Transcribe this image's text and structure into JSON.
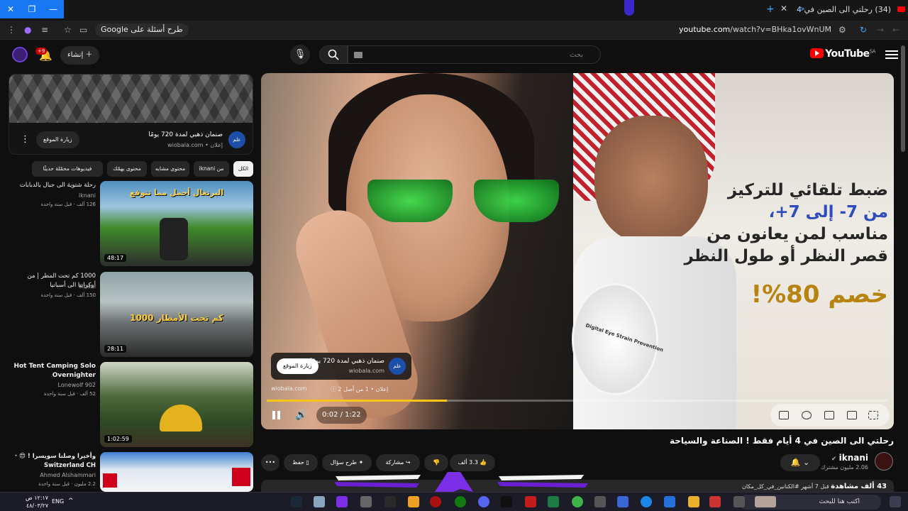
{
  "browser": {
    "tab_title": "(34) رحلتي الى الصين في 4",
    "url_host": "youtube.com",
    "url_path": "/watch?v=BHka1ovWnUM",
    "ask_google": "طرح أسئلة على Google"
  },
  "yt": {
    "logo_text": "YouTube",
    "region": "SA",
    "search_placeholder": "بحث",
    "create_label": "إنشاء",
    "notif_count": "+9"
  },
  "player": {
    "ad_lines": [
      "ضبط تلقائي للتركيز",
      "من 7- إلى 7+،",
      "مناسب لمن يعانون من",
      "قصر النظر أو طول النظر"
    ],
    "ad_discount": "خصم 80%!",
    "inset_text": "Digital Eye Strain Prevention",
    "ad_card_logo": "علم",
    "ad_card_title": "صنمان ذهبي لمدة 720 يومًا",
    "ad_card_domain": "wiobala.com",
    "ad_card_visit": "زيارة الموقع",
    "ad_domain": "wiobala.com",
    "ad_sponsor": "إعلان • 1 من أصل 2 ⓘ",
    "time": "0:02 / 1:22",
    "progress": 0.29
  },
  "video": {
    "title": "رحلتي الى الصين في 4 أيام فقط ! الصناعة والسياحة",
    "channel": "iknani",
    "subs": "2.06 مليون مشترك",
    "likes": "3.3 ألف",
    "ask_label": "طرح سؤال",
    "share_label": "مشاركة",
    "save_label": "حفظ",
    "desc_views": "43 ألف مشاهدة",
    "desc_rest": " قبل 7 أشهر #الكنانين_في_كل_مكان"
  },
  "sidebar_ad": {
    "logo": "علم",
    "title": "صنمان ذهبي لمدة 720 يومًا",
    "sponsor": "إعلان • wiobala.com",
    "visit": "زيارة الموقع"
  },
  "chips": [
    "الكل",
    "من iknani",
    "محتوى مشابه",
    "محتوى يهمّك",
    "فيديوهات محمّلة حديثًا"
  ],
  "recommendations": [
    {
      "title": "رحلة شتوية الى جبال بالدبابات",
      "channel": "iknani",
      "meta": "126 ألف · قبل سنة واحدة",
      "duration": "48:17",
      "thumb_text": "البرتغال أجمل مما تتوقع"
    },
    {
      "title": "1000 كم تحت المطر | من أوكرانيا الى أسبانيا",
      "channel": "iknani",
      "meta": "150 ألف · قبل سنة واحدة",
      "duration": "28:11",
      "thumb_text": "1000 كم تحت الأمطار"
    },
    {
      "title": "Hot Tent Camping Solo Overnighter",
      "channel": "Lonewolf 902",
      "meta": "52 ألف · قبل سنة واحدة",
      "duration": "1:02:59",
      "thumb_text": ""
    },
    {
      "title": "وأخيرا وصلنا سويسرا ! 😍 · Switzerland CH",
      "channel": "Ahmed Alshammari",
      "meta": "2.2 مليون · قبل سنة واحدة",
      "duration": "",
      "thumb_text": ""
    }
  ],
  "taskbar": {
    "search_placeholder": "اكتب هنا للبحث",
    "lang": "ENG",
    "time": "١٢:١٧ ص",
    "date": "٤٨/٠٣/٢٧"
  },
  "colors": {
    "yt_red": "#ff0000",
    "progress": "#f5c518",
    "ad_blue": "#2d4dbf",
    "discount_gold": "#b88411"
  }
}
